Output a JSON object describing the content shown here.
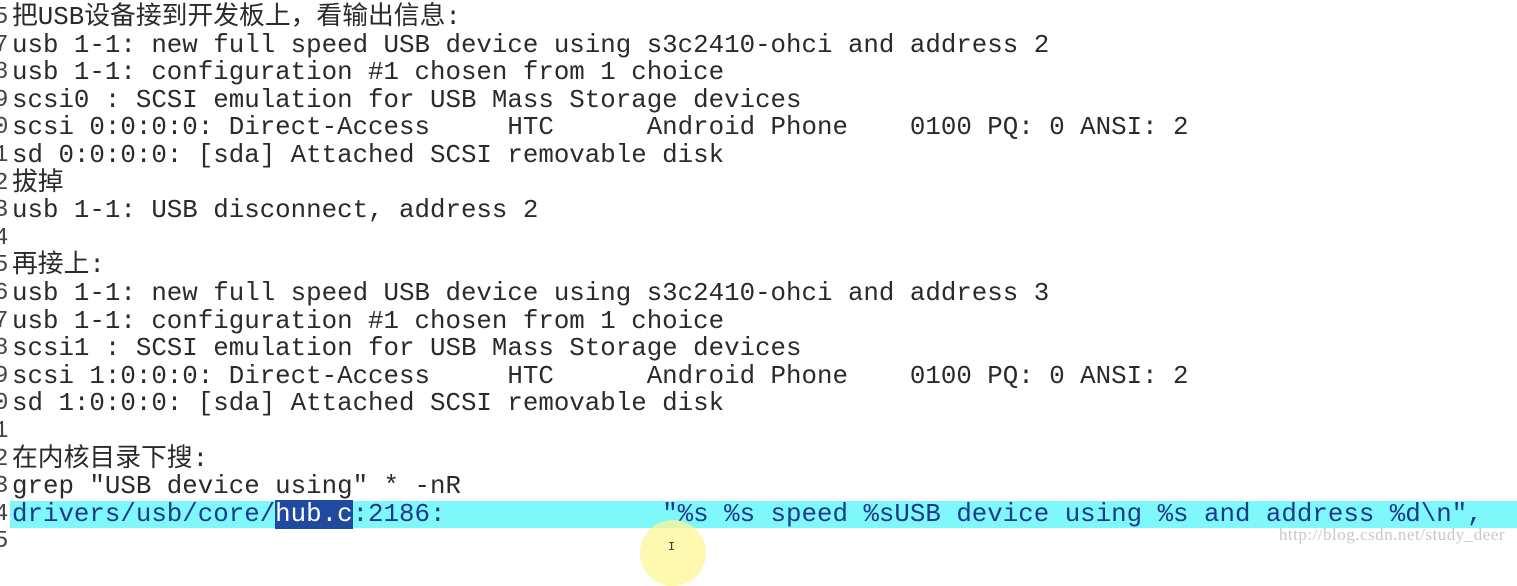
{
  "editor": {
    "lines": [
      {
        "num": "5",
        "text": "把USB设备接到开发板上，看输出信息:"
      },
      {
        "num": "7",
        "text": "usb 1-1: new full speed USB device using s3c2410-ohci and address 2"
      },
      {
        "num": "8",
        "text": "usb 1-1: configuration #1 chosen from 1 choice"
      },
      {
        "num": "9",
        "text": "scsi0 : SCSI emulation for USB Mass Storage devices"
      },
      {
        "num": "0",
        "text": "scsi 0:0:0:0: Direct-Access     HTC      Android Phone    0100 PQ: 0 ANSI: 2"
      },
      {
        "num": "1",
        "text": "sd 0:0:0:0: [sda] Attached SCSI removable disk"
      },
      {
        "num": "2",
        "text": "拔掉"
      },
      {
        "num": "3",
        "text": "usb 1-1: USB disconnect, address 2"
      },
      {
        "num": "4",
        "text": ""
      },
      {
        "num": "5",
        "text": "再接上:"
      },
      {
        "num": "6",
        "text": "usb 1-1: new full speed USB device using s3c2410-ohci and address 3"
      },
      {
        "num": "7",
        "text": "usb 1-1: configuration #1 chosen from 1 choice"
      },
      {
        "num": "8",
        "text": "scsi1 : SCSI emulation for USB Mass Storage devices"
      },
      {
        "num": "9",
        "text": "scsi 1:0:0:0: Direct-Access     HTC      Android Phone    0100 PQ: 0 ANSI: 2"
      },
      {
        "num": "0",
        "text": "sd 1:0:0:0: [sda] Attached SCSI removable disk"
      },
      {
        "num": "1",
        "text": ""
      },
      {
        "num": "2",
        "text": "在内核目录下搜:"
      },
      {
        "num": "3",
        "text": "grep \"USB device using\" * -nR"
      }
    ],
    "highlighted_line": {
      "num": "4",
      "before": "drivers/usb/core/",
      "selected": "hub.c",
      "after": ":2186:              \"%s %s speed %sUSB device using %s and address %d\\n\","
    },
    "last_line_num": "5"
  },
  "watermark": "http://blog.csdn.net/study_deer",
  "colors": {
    "line_highlight": "#7ff8fb",
    "selection": "#1f4aa0",
    "cursor_ring": "#fff596"
  }
}
